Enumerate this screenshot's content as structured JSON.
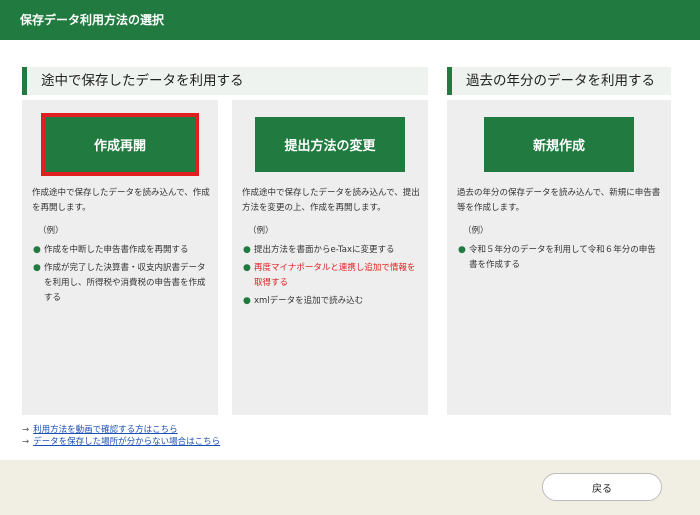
{
  "header": {
    "title": "保存データ利用方法の選択"
  },
  "sections": {
    "resume_title": "途中で保存したデータを利用する",
    "past_title": "過去の年分のデータを利用する"
  },
  "cards": [
    {
      "button_label": "作成再開",
      "description": "作成途中で保存したデータを読み込んで、作成を再開します。",
      "example_label": "（例）",
      "examples": [
        "作成を中断した申告書作成を再開する",
        "作成が完了した決算書・収支内訳書データを利用し、所得税や消費税の申告書を作成する"
      ]
    },
    {
      "button_label": "提出方法の変更",
      "description": "作成途中で保存したデータを読み込んで、提出方法を変更の上、作成を再開します。",
      "example_label": "（例）",
      "examples": [
        "提出方法を書面からe-Taxに変更する",
        "再度マイナポータルと連携し追加で情報を取得する",
        "xmlデータを追加で読み込む"
      ]
    },
    {
      "button_label": "新規作成",
      "description": "過去の年分の保存データを読み込んで、新規に申告書等を作成します。",
      "example_label": "（例）",
      "examples": [
        "令和５年分のデータを利用して令和６年分の申告書を作成する"
      ]
    }
  ],
  "links": [
    "利用方法を動画で確認する方はこちら",
    "データを保存した場所が分からない場合はこちら"
  ],
  "footer": {
    "back_label": "戻る"
  },
  "colors": {
    "primary_green": "#217a3f",
    "highlight_red": "#e02020",
    "link_blue": "#1a4fb5"
  }
}
